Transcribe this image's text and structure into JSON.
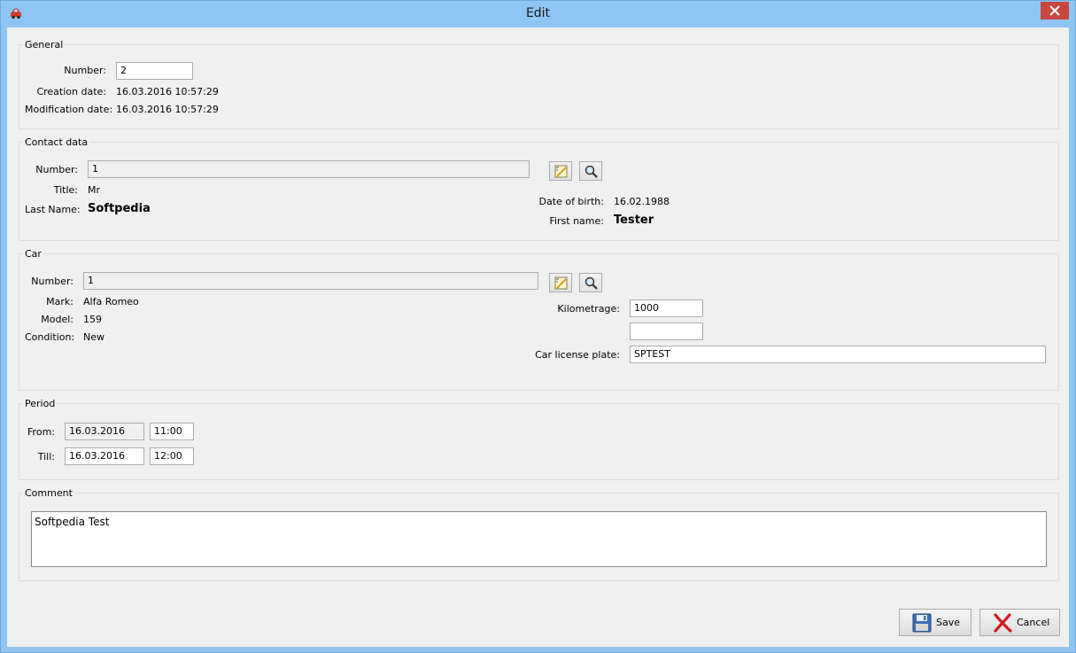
{
  "window": {
    "title": "Edit"
  },
  "general": {
    "legend": "General",
    "number_label": "Number:",
    "number_value": "2",
    "creation_label": "Creation date:",
    "creation_value": "16.03.2016  10:57:29",
    "modification_label": "Modification date:",
    "modification_value": "16.03.2016  10:57:29"
  },
  "contact": {
    "legend": "Contact data",
    "number_label": "Number:",
    "number_value": "1",
    "title_label": "Title:",
    "title_value": "Mr",
    "lastname_label": "Last Name:",
    "lastname_value": "Softpedia",
    "dob_label": "Date of birth:",
    "dob_value": "16.02.1988",
    "firstname_label": "First name:",
    "firstname_value": "Tester"
  },
  "car": {
    "legend": "Car",
    "number_label": "Number:",
    "number_value": "1",
    "mark_label": "Mark:",
    "mark_value": "Alfa Romeo",
    "model_label": "Model:",
    "model_value": "159",
    "condition_label": "Condition:",
    "condition_value": "New",
    "km_label": "Kilometrage:",
    "km_value": "1000",
    "extra_value": "",
    "plate_label": "Car license plate:",
    "plate_value": "SPTEST"
  },
  "period": {
    "legend": "Period",
    "from_label": "From:",
    "from_date": "16.03.2016",
    "from_time": "11:00",
    "till_label": "Till:",
    "till_date": "16.03.2016",
    "till_time": "12:00"
  },
  "comment": {
    "legend": "Comment",
    "text": "Softpedia Test"
  },
  "buttons": {
    "save": "Save",
    "cancel": "Cancel"
  },
  "icons": {
    "app": "car-icon",
    "clear": "clear-icon",
    "search": "magnifier-icon",
    "save": "floppy-disk-icon",
    "cancel": "red-x-icon"
  }
}
